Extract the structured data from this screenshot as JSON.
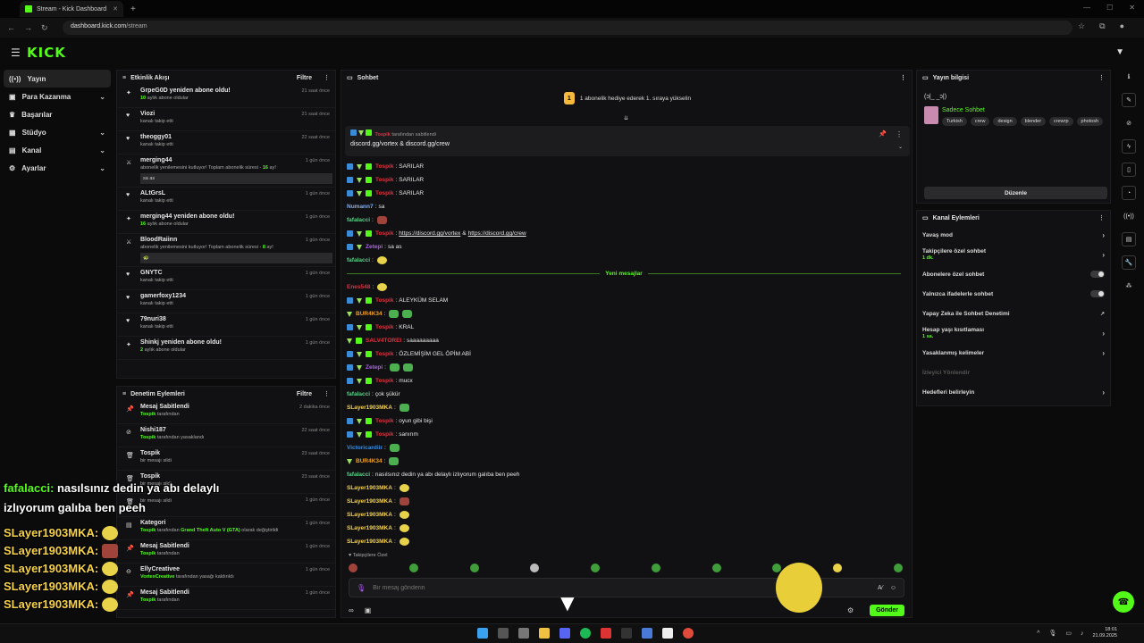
{
  "browser": {
    "tab_title": "Stream - Kick Dashboard",
    "url_host": "dashboard.kick.com",
    "url_path": "/stream"
  },
  "brand": {
    "logo": "KICK",
    "accent": "#53fc18"
  },
  "sidebar": {
    "items": [
      {
        "label": "Yayın",
        "icon": "broadcast-icon",
        "active": true
      },
      {
        "label": "Para Kazanma",
        "icon": "money-icon",
        "expandable": true
      },
      {
        "label": "Başarılar",
        "icon": "trophy-icon"
      },
      {
        "label": "Stüdyo",
        "icon": "studio-icon",
        "expandable": true
      },
      {
        "label": "Kanal",
        "icon": "channel-icon",
        "expandable": true
      },
      {
        "label": "Ayarlar",
        "icon": "settings-icon",
        "expandable": true
      }
    ]
  },
  "activity": {
    "title": "Etkinlik Akışı",
    "filter": "Filtre",
    "events": [
      {
        "icon": "star-icon",
        "title": "GrpeG0D yeniden abone oldu!",
        "sub_strong": "10",
        "sub": " aylık abone oldular",
        "time": "21 saat önce"
      },
      {
        "icon": "heart-icon",
        "title": "Viozi",
        "sub": "kanalı takip etti",
        "time": "21 saat önce"
      },
      {
        "icon": "heart-icon",
        "title": "theoggy01",
        "sub": "kanalı takip etti",
        "time": "22 saat önce"
      },
      {
        "icon": "sword-icon",
        "title": "merging44",
        "sub": "abonelik yenilemesini kutluyor! Toplam abonelik süresi - ",
        "sub_strong": "16",
        "sub_end": " ay!",
        "box": "sa as",
        "time": "1 gün önce"
      },
      {
        "icon": "heart-icon",
        "title": "ALtGrsL",
        "sub": "kanalı takip etti",
        "time": "1 gün önce"
      },
      {
        "icon": "star-icon",
        "title": "merging44 yeniden abone oldu!",
        "sub_strong": "16",
        "sub": " aylık abone oldular",
        "time": "1 gün önce"
      },
      {
        "icon": "sword-icon",
        "title": "BloodRaiinn",
        "sub": "abonelik yenilemesini kutluyor! Toplam abonelik süresi - ",
        "sub_strong": "8",
        "sub_end": " ay!",
        "box": "🐢",
        "time": "1 gün önce"
      },
      {
        "icon": "heart-icon",
        "title": "GNYTC",
        "sub": "kanalı takip etti",
        "time": "1 gün önce"
      },
      {
        "icon": "heart-icon",
        "title": "gamerfoxy1234",
        "sub": "kanalı takip etti",
        "time": "1 gün önce"
      },
      {
        "icon": "heart-icon",
        "title": "79nuri38",
        "sub": "kanalı takip etti",
        "time": "1 gün önce"
      },
      {
        "icon": "star-icon",
        "title": "Shinkj yeniden abone oldu!",
        "sub_strong": "2",
        "sub": " aylık abone oldular",
        "time": "1 gün önce"
      }
    ]
  },
  "moderation": {
    "title": "Denetim Eylemleri",
    "filter": "Filtre",
    "events": [
      {
        "icon": "pin-icon",
        "title": "Mesaj Sabitlendi",
        "sub_strong": "Tospik",
        "sub": " tarafından",
        "time": "2 dakika önce"
      },
      {
        "icon": "ban-icon",
        "title": "Nishi187",
        "sub_strong": "Tospik",
        "sub": " tarafından yasaklandı",
        "time": "22 saat önce"
      },
      {
        "icon": "trash-icon",
        "title": "Tospik",
        "sub": "bir mesajı sildi",
        "time": "23 saat önce"
      },
      {
        "icon": "trash-icon",
        "title": "Tospik",
        "sub": "bir mesajı sildi",
        "time": "23 saat önce"
      },
      {
        "icon": "trash-icon",
        "title": "",
        "sub": "bir mesajı sildi",
        "time": "1 gün önce"
      },
      {
        "icon": "tag-icon",
        "title": "Kategori",
        "sub_strong": "Tospik",
        "sub": " tarafından ",
        "sub_strong2": "Grand Theft Auto V (GTA)",
        "sub_end": " olarak değiştirildi",
        "time": "1 gün önce"
      },
      {
        "icon": "pin-icon",
        "title": "Mesaj Sabitlendi",
        "sub_strong": "Tospik",
        "sub": " tarafından",
        "time": "1 gün önce"
      },
      {
        "icon": "unban-icon",
        "title": "EllyCreativee",
        "sub_strong": "VortexCreative",
        "sub": " tarafından yasağı kaldırıldı",
        "time": "1 gün önce"
      },
      {
        "icon": "pin-icon",
        "title": "Mesaj Sabitlendi",
        "sub_strong": "Tospik",
        "sub": " tarafından",
        "time": "1 gün önce"
      }
    ]
  },
  "chat": {
    "title": "Sohbet",
    "banner": "1 abonelik hediye ederek 1. sıraya yükselin",
    "pinned_by": "Tospik",
    "pinned_by_suffix": " tarafından sabitlendi",
    "pinned_text": "discord.gg/vortex & discord.gg/crew",
    "new_messages_label": "Yeni mesajlar",
    "messages": [
      {
        "user": "Tospik",
        "color": "#e0303f",
        "badges": "bvg",
        "text": "SARILAR"
      },
      {
        "user": "Tospik",
        "color": "#e0303f",
        "badges": "bvg",
        "text": "SARILAR"
      },
      {
        "user": "Tospik",
        "color": "#e0303f",
        "badges": "bvg",
        "text": "SARILAR"
      },
      {
        "user": "Numann7",
        "color": "#7fb0ff",
        "badges": "",
        "text": "sa"
      },
      {
        "user": "fafalacci",
        "color": "#5ad28a",
        "badges": "",
        "text": "",
        "emote": "r"
      },
      {
        "user": "Tospik",
        "color": "#e0303f",
        "badges": "bvg",
        "text": "",
        "links": [
          "https://discord.gg/vortex",
          " & ",
          "https://discord.gg/crew"
        ]
      },
      {
        "user": "Zetepi",
        "color": "#b45cf5",
        "badges": "bv",
        "text": "sa as"
      },
      {
        "user": "fafalacci",
        "color": "#5ad28a",
        "badges": "",
        "text": "",
        "emote": "y"
      },
      {
        "sep": true
      },
      {
        "user": "Enes548",
        "color": "#e0303f",
        "badges": "",
        "text": "",
        "emote": "y"
      },
      {
        "user": "Tospik",
        "color": "#e0303f",
        "badges": "bvg",
        "text": "ALEYKÜM SELAM"
      },
      {
        "user": "BUR4K34",
        "color": "#f0a020",
        "badges": "v",
        "text": "",
        "emote": "g2"
      },
      {
        "user": "Tospik",
        "color": "#e0303f",
        "badges": "bvg",
        "text": "KRAL"
      },
      {
        "user": "SALV4TOREI",
        "color": "#e0303f",
        "badges": "vg",
        "text": "saaaaaaaaa"
      },
      {
        "user": "Tospik",
        "color": "#e0303f",
        "badges": "bvg",
        "text": "ÖZLEMİŞİM GEL ÖPİM ABİ"
      },
      {
        "user": "Zetepi",
        "color": "#b45cf5",
        "badges": "bv",
        "text": "",
        "emote": "g2"
      },
      {
        "user": "Tospik",
        "color": "#e0303f",
        "badges": "bvg",
        "text": "mucx"
      },
      {
        "user": "fafalacci",
        "color": "#5ad28a",
        "badges": "",
        "text": "çok şükür"
      },
      {
        "user": "SLayer1903MKA",
        "color": "#f6d24a",
        "badges": "",
        "text": "",
        "emote": "g"
      },
      {
        "user": "Tospik",
        "color": "#e0303f",
        "badges": "bvg",
        "text": "oyun gibi bişi"
      },
      {
        "user": "Tospik",
        "color": "#e0303f",
        "badges": "bvg",
        "text": "sanırım"
      },
      {
        "user": "Victoricardiir",
        "color": "#3a8bd8",
        "badges": "",
        "text": "",
        "emote": "g"
      },
      {
        "user": "BUR4K34",
        "color": "#f0a020",
        "badges": "v",
        "text": "",
        "emote": "g"
      },
      {
        "user": "fafalacci",
        "color": "#5ad28a",
        "badges": "",
        "text": "nasılsınız dedin ya abı delaylı izlıyorum galıba ben peeh"
      },
      {
        "user": "SLayer1903MKA",
        "color": "#f6d24a",
        "badges": "",
        "text": "",
        "emote": "y"
      },
      {
        "user": "SLayer1903MKA",
        "color": "#f6d24a",
        "badges": "",
        "text": "",
        "emote": "r"
      },
      {
        "user": "SLayer1903MKA",
        "color": "#f6d24a",
        "badges": "",
        "text": "",
        "emote": "y"
      },
      {
        "user": "SLayer1903MKA",
        "color": "#f6d24a",
        "badges": "",
        "text": "",
        "emote": "y"
      },
      {
        "user": "SLayer1903MKA",
        "color": "#f6d24a",
        "badges": "",
        "text": "",
        "emote": "y"
      }
    ],
    "followers_label": "Takipçilere Özel",
    "input_placeholder": "Bir mesaj gönderin",
    "send_label": "Gönder"
  },
  "stream_info": {
    "title": "Yayın bilgisi",
    "stream_title": "(ɔ|_ _ɔ|)",
    "category": "Sadece Sohbet",
    "tags": [
      "Turkish",
      "crew",
      "design",
      "blender",
      "crewrp",
      "photosh"
    ],
    "edit_label": "Düzenle"
  },
  "channel_actions": {
    "title": "Kanal Eylemleri",
    "items": [
      {
        "label": "Yavaş mod",
        "kind": "chevron"
      },
      {
        "label": "Takipçilere özel sohbet",
        "sub": "1 dk.",
        "kind": "chevron"
      },
      {
        "label": "Abonelere özel sohbet",
        "kind": "toggle"
      },
      {
        "label": "Yalnızca ifadelerle sohbet",
        "kind": "toggle"
      },
      {
        "label": "Yapay Zeka ile Sohbet Denetimi",
        "kind": "external"
      },
      {
        "label": "Hesap yaşı kısıtlaması",
        "sub": "1 sa.",
        "kind": "chevron"
      },
      {
        "label": "Yasaklanmış kelimeler",
        "kind": "chevron"
      },
      {
        "label": "İzleyici Yönlendir",
        "kind": "disabled"
      },
      {
        "label": "Hedefleri belirleyin",
        "kind": "chevron"
      }
    ]
  },
  "overlay": {
    "line1_user": "fafalacci:",
    "line1_text": " nasılsınız dedin ya abı delaylı",
    "line2_text": "izlıyorum galıba ben peeh",
    "repeat_user": "SLayer1903MKA:"
  },
  "clock": {
    "time": "18:01",
    "date": "21.09.2025"
  }
}
